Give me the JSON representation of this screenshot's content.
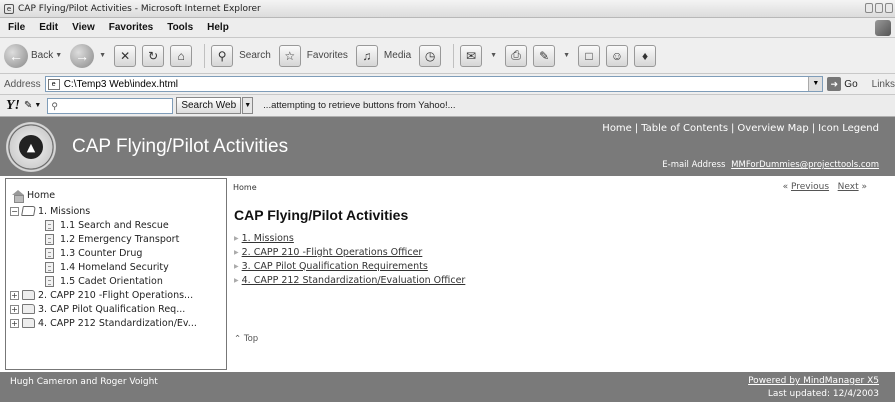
{
  "window": {
    "title": "CAP Flying/Pilot Activities - Microsoft Internet Explorer"
  },
  "menu": [
    "File",
    "Edit",
    "View",
    "Favorites",
    "Tools",
    "Help"
  ],
  "toolbar": {
    "back": "Back",
    "search": "Search",
    "favorites": "Favorites",
    "media": "Media"
  },
  "address": {
    "label": "Address",
    "url": "C:\\Temp3 Web\\index.html",
    "go": "Go",
    "links": "Links"
  },
  "yahoo": {
    "search_button": "Search Web",
    "status": "...attempting to retrieve buttons from Yahoo!..."
  },
  "header": {
    "site_title": "CAP Flying/Pilot Activities",
    "nav_links": [
      "Home",
      "Table of Contents",
      "Overview Map",
      "Icon Legend"
    ],
    "email_label": "E-mail Address",
    "email": "MMForDummies@projecttools.com"
  },
  "tree": {
    "home": "Home",
    "items": [
      {
        "label": "1. Missions",
        "toggle": "−"
      },
      {
        "label": "1.1 Search and Rescue"
      },
      {
        "label": "1.2 Emergency Transport"
      },
      {
        "label": "1.3 Counter Drug"
      },
      {
        "label": "1.4 Homeland Security"
      },
      {
        "label": "1.5 Cadet Orientation"
      },
      {
        "label": "2. CAPP 210 -Flight Operations...",
        "toggle": "+"
      },
      {
        "label": "3. CAP Pilot Qualification Req...",
        "toggle": "+"
      },
      {
        "label": "4. CAPP 212 Standardization/Ev...",
        "toggle": "+"
      }
    ]
  },
  "content": {
    "breadcrumb": "Home",
    "previous": "Previous",
    "next": "Next",
    "heading": "CAP Flying/Pilot Activities",
    "topics": [
      "1. Missions",
      "2. CAPP 210 -Flight Operations Officer",
      "3. CAP Pilot Qualification Requirements",
      "4. CAPP 212 Standardization/Evaluation Officer"
    ],
    "top_link": "Top"
  },
  "footer": {
    "authors": "Hugh Cameron and Roger Voight",
    "powered": "Powered by MindManager X5",
    "updated": "Last updated: 12/4/2003"
  }
}
